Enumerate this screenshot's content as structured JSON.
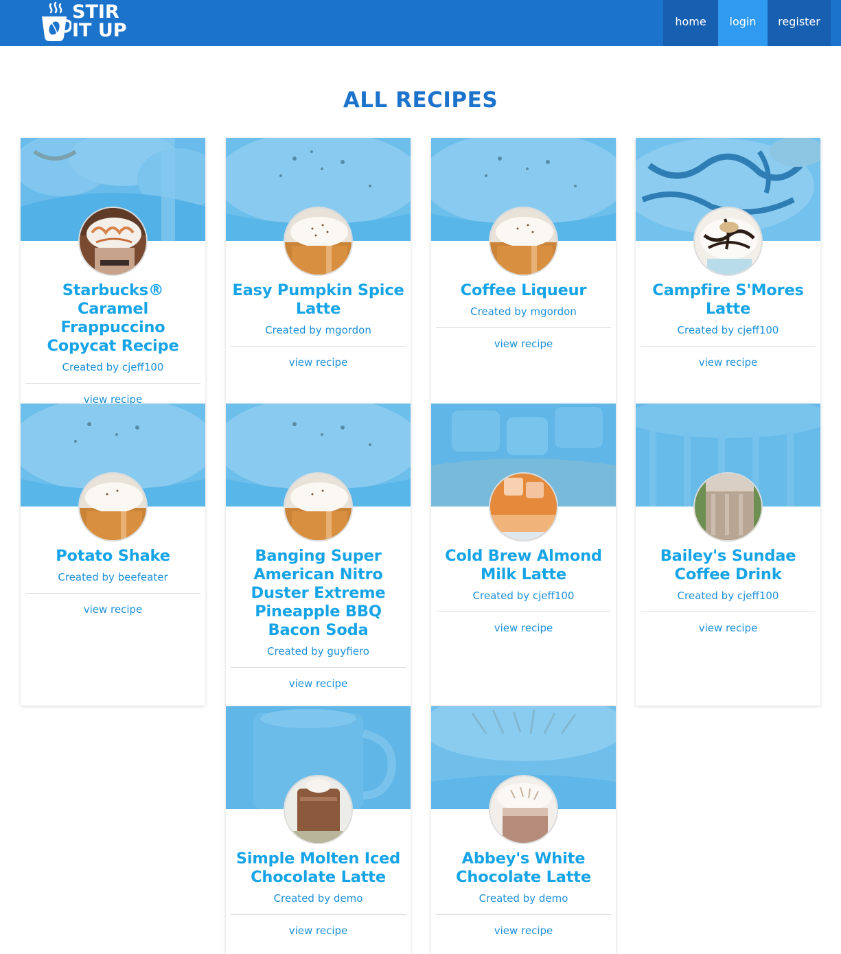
{
  "navbar": {
    "brand_line1": "STIR",
    "brand_line2": "IT UP",
    "brand_icon": "coffee-cup-icon",
    "links": [
      {
        "label": "home"
      },
      {
        "label": "login"
      },
      {
        "label": "register"
      }
    ],
    "colors": {
      "bar": "#1c73cb",
      "link_bg": "#175fb0",
      "active_bg": "#2f9af0"
    }
  },
  "page": {
    "title": "ALL RECIPES"
  },
  "recipes": [
    {
      "title": "Starbucks® Caramel Frappuccino Copycat Recipe",
      "author": "Created by cjeff100",
      "link": "view recipe",
      "drink": "caramel"
    },
    {
      "title": "Easy Pumpkin Spice Latte",
      "author": "Created by mgordon",
      "link": "view recipe",
      "drink": "pumpkin"
    },
    {
      "title": "Coffee Liqueur",
      "author": "Created by mgordon",
      "link": "view recipe",
      "drink": "pumpkin"
    },
    {
      "title": "Campfire S'Mores Latte",
      "author": "Created by cjeff100",
      "link": "view recipe",
      "drink": "smores"
    },
    {
      "title": "Potato Shake",
      "author": "Created by beefeater",
      "link": "view recipe",
      "drink": "pumpkin"
    },
    {
      "title": "Banging Super American Nitro Duster Extreme Pineapple BBQ Bacon Soda",
      "author": "Created by guyfiero",
      "link": "view recipe",
      "drink": "pumpkin"
    },
    {
      "title": "Cold Brew Almond Milk Latte",
      "author": "Created by cjeff100",
      "link": "view recipe",
      "drink": "coldbrew"
    },
    {
      "title": "Bailey's Sundae Coffee Drink",
      "author": "Created by cjeff100",
      "link": "view recipe",
      "drink": "baileys"
    },
    {
      "title": "Simple Molten Iced Chocolate Latte",
      "author": "Created by demo",
      "link": "view recipe",
      "drink": "chocolate"
    },
    {
      "title": "Abbey's White Chocolate Latte",
      "author": "Created by demo",
      "link": "view recipe",
      "drink": "whitechoc"
    }
  ],
  "accent_colors": {
    "title": "#17a4e6",
    "text": "#1c8fd6",
    "heading": "#1c73cb"
  }
}
